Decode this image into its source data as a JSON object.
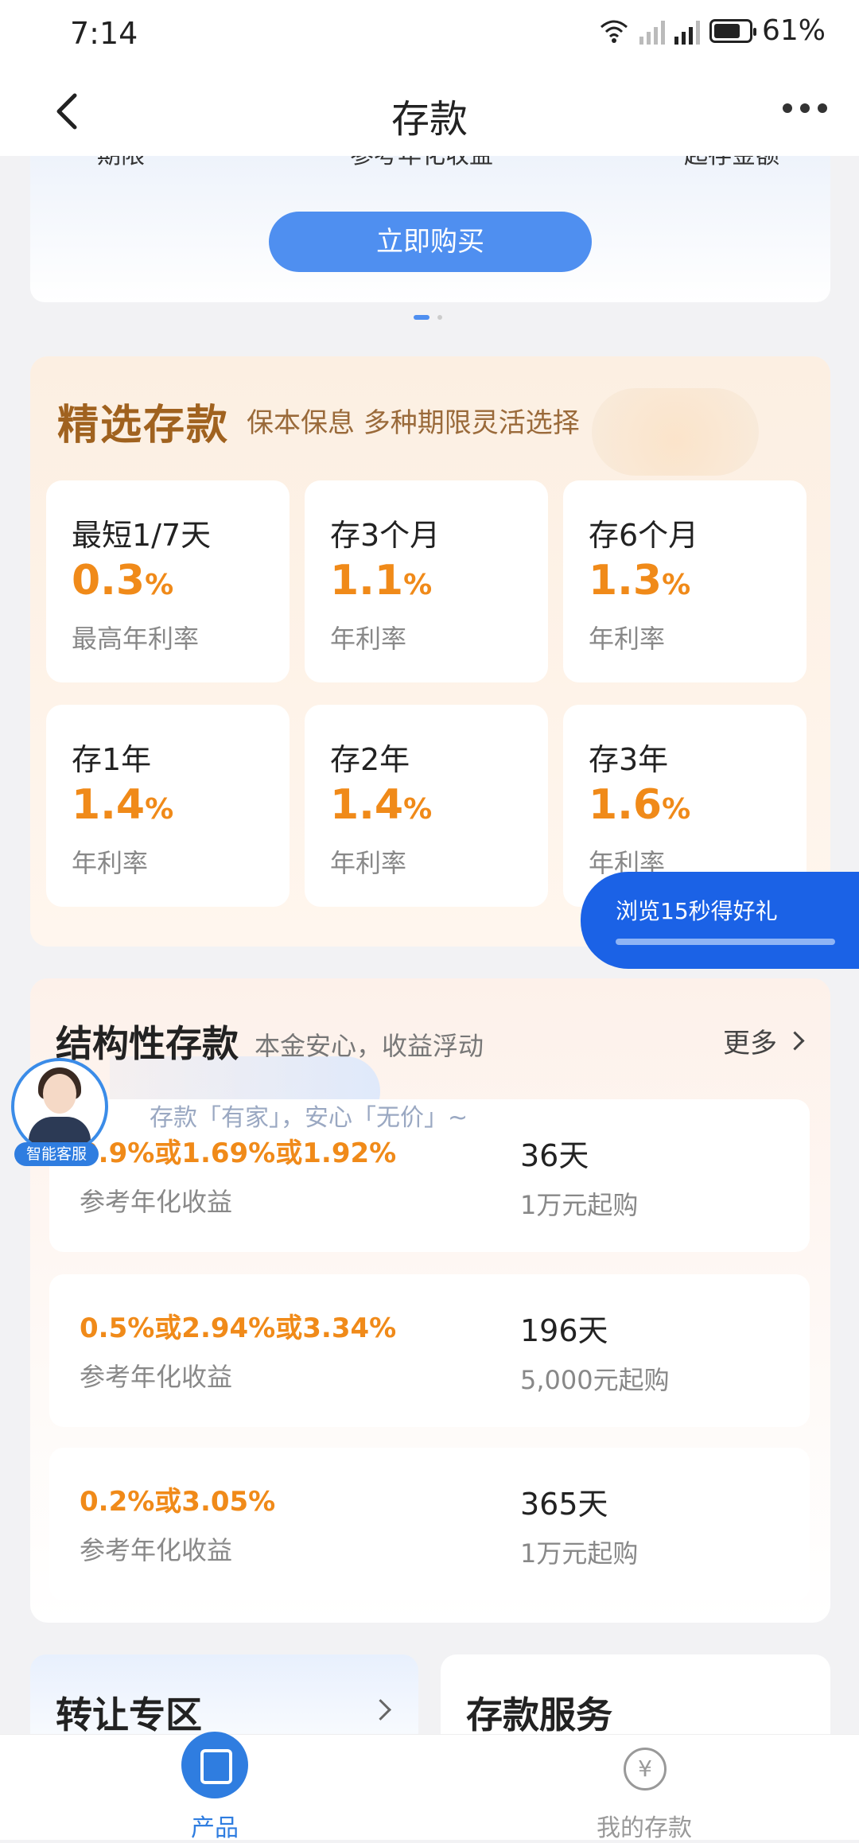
{
  "status_bar": {
    "time": "7:14",
    "battery": "61%",
    "network": "4G"
  },
  "header": {
    "title": "存款"
  },
  "top_card": {
    "cut_labels": [
      "期限",
      "参考年化收益",
      "起存金额"
    ],
    "buy_button": "立即购买"
  },
  "selected": {
    "title": "精选存款",
    "subtitle": "保本保息 多种期限灵活选择",
    "tiles": [
      {
        "name": "最短1/7天",
        "rate": "0.3",
        "unit": "%",
        "desc": "最高年利率"
      },
      {
        "name": "存3个月",
        "rate": "1.1",
        "unit": "%",
        "desc": "年利率"
      },
      {
        "name": "存6个月",
        "rate": "1.3",
        "unit": "%",
        "desc": "年利率"
      },
      {
        "name": "存1年",
        "rate": "1.4",
        "unit": "%",
        "desc": "年利率"
      },
      {
        "name": "存2年",
        "rate": "1.4",
        "unit": "%",
        "desc": "年利率"
      },
      {
        "name": "存3年",
        "rate": "1.6",
        "unit": "%",
        "desc": "年利率"
      }
    ]
  },
  "promo": {
    "text": "浏览15秒得好礼",
    "progress": 1.0
  },
  "structured": {
    "title": "结构性存款",
    "subtitle": "本金安心，收益浮动",
    "more": "更多",
    "banner": "存款「有家」，安心「无价」~",
    "products": [
      {
        "rate": "0.9%或1.69%或1.92%",
        "rate_label": "参考年化收益",
        "days": "36天",
        "min": "1万元起购"
      },
      {
        "rate": "0.5%或2.94%或3.34%",
        "rate_label": "参考年化收益",
        "days": "196天",
        "min": "5,000元起购"
      },
      {
        "rate": "0.2%或3.05%",
        "rate_label": "参考年化收益",
        "days": "365天",
        "min": "1万元起购"
      }
    ]
  },
  "assistant": {
    "label": "智能客服"
  },
  "bottom_cards": {
    "transfer": "转让专区",
    "service": "存款服务"
  },
  "tabs": [
    {
      "label": "产品",
      "active": true,
      "color": "#2f7de0"
    },
    {
      "label": "我的存款",
      "active": false,
      "color": "#999999",
      "icon_glyph": "¥"
    }
  ]
}
